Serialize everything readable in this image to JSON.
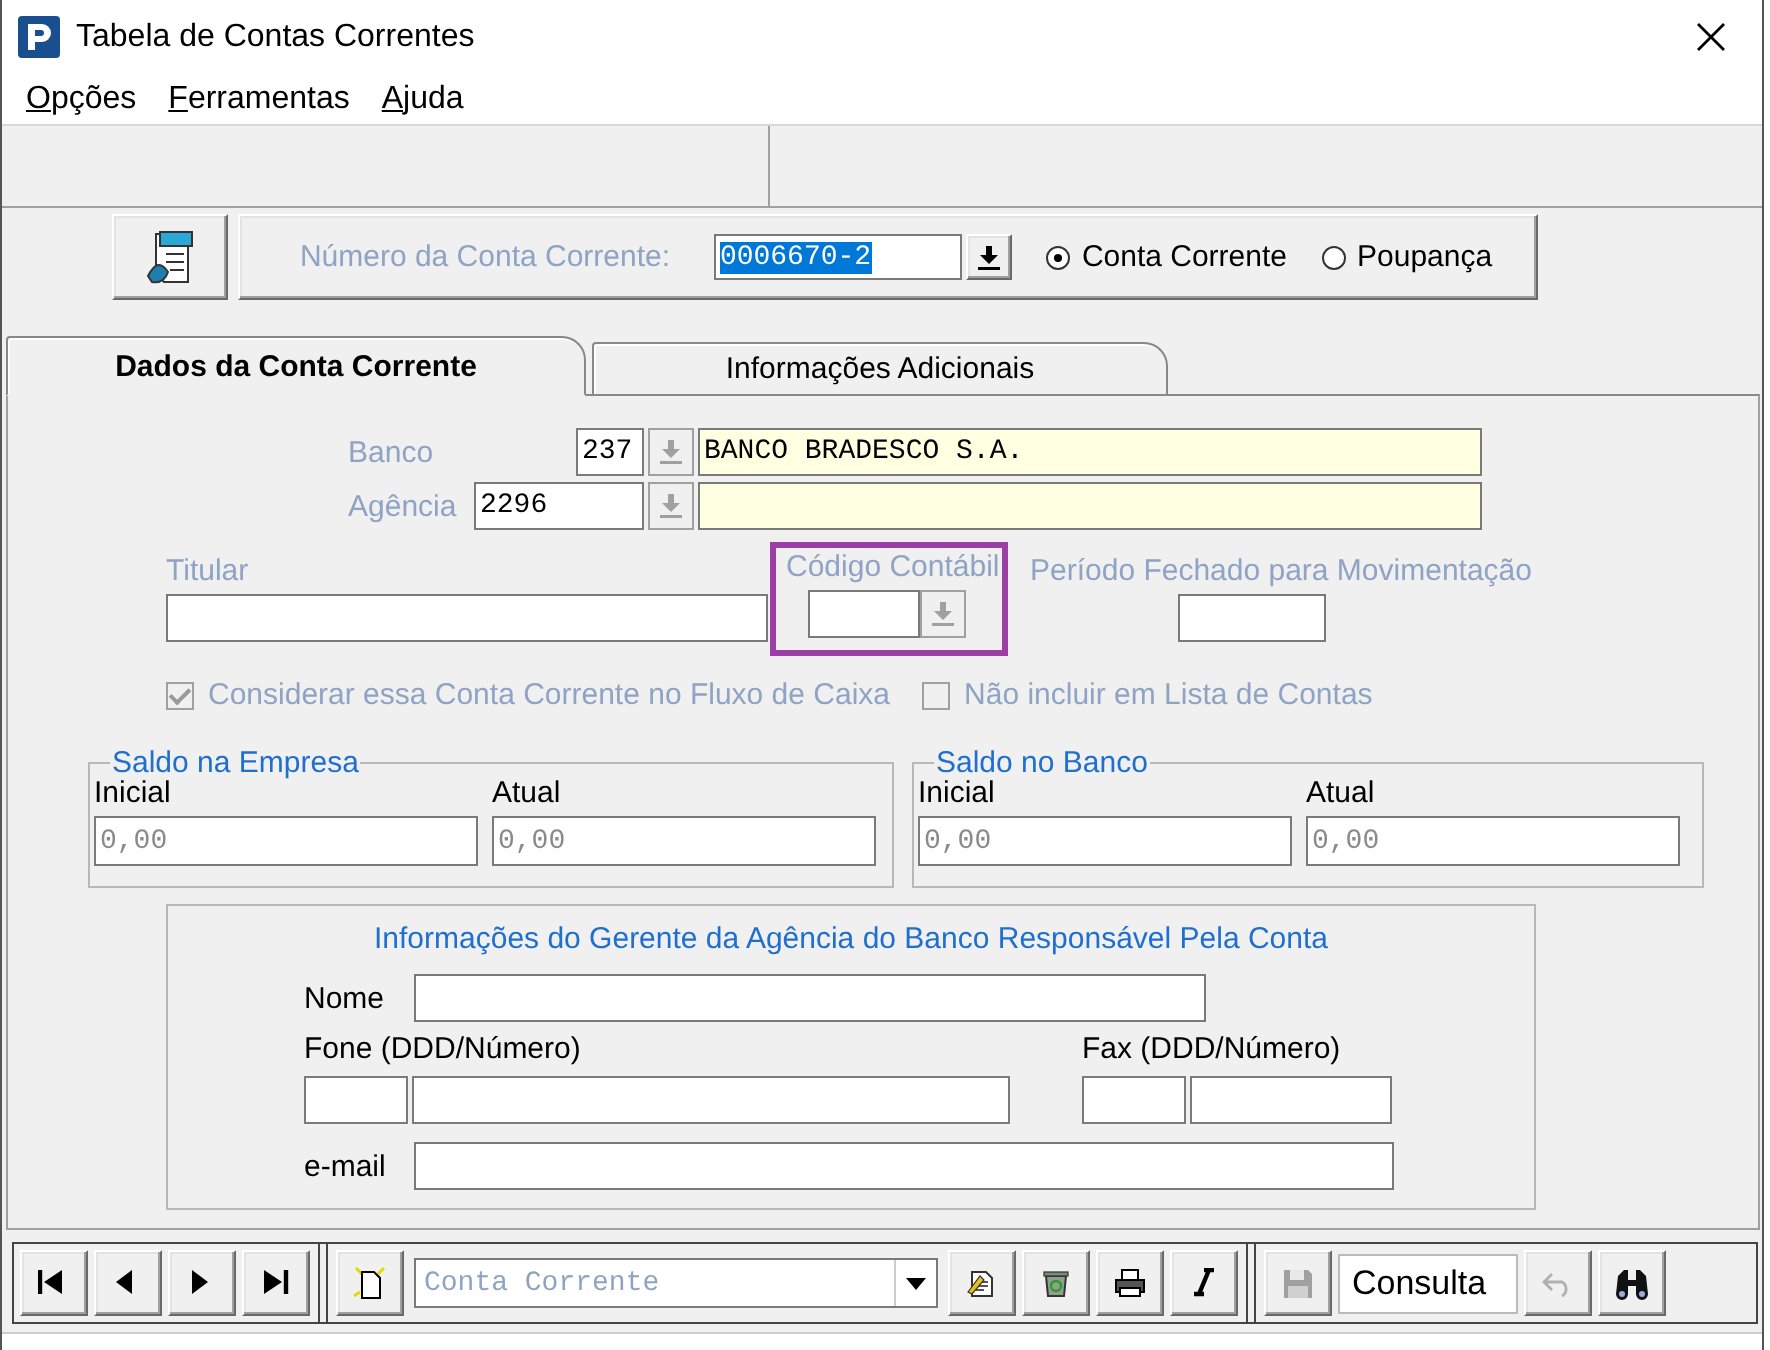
{
  "window": {
    "title": "Tabela de Contas Correntes"
  },
  "menu": [
    {
      "label": "Opções"
    },
    {
      "label": "Ferramentas"
    },
    {
      "label": "Ajuda"
    }
  ],
  "account": {
    "label": "Número da Conta Corrente:",
    "value": "0006670-2",
    "types": [
      {
        "label": "Conta Corrente",
        "selected": true
      },
      {
        "label": "Poupança",
        "selected": false
      }
    ]
  },
  "tabs": [
    {
      "label": "Dados da Conta Corrente",
      "selected": true
    },
    {
      "label": "Informações Adicionais",
      "selected": false
    }
  ],
  "bank": {
    "label": "Banco",
    "code": "237",
    "name": "BANCO BRADESCO S.A.",
    "disabled": true
  },
  "agency": {
    "label": "Agência",
    "code": "2296",
    "disabled": true
  },
  "holder": {
    "label": "Titular",
    "disabled": true
  },
  "ledger_code": {
    "label": "Código Contábil",
    "disabled": true,
    "highlighted": true
  },
  "closed_period": {
    "label": "Período Fechado para Movimentação",
    "disabled": true
  },
  "options": [
    {
      "label": "Considerar essa Conta Corrente no Fluxo de Caixa",
      "checked": true,
      "disabled": true
    },
    {
      "label": "Não incluir em Lista de Contas",
      "checked": false,
      "disabled": true
    }
  ],
  "balances": [
    {
      "title": "Saldo na Empresa",
      "fields": [
        {
          "label": "Inicial",
          "value": "0,00"
        },
        {
          "label": "Atual",
          "value": "0,00"
        }
      ]
    },
    {
      "title": "Saldo no Banco",
      "fields": [
        {
          "label": "Inicial",
          "value": "0,00"
        },
        {
          "label": "Atual",
          "value": "0,00"
        }
      ]
    }
  ],
  "manager": {
    "title": "Informações do Gerente da Agência do Banco Responsável Pela Conta",
    "name_label": "Nome",
    "phone_label": "Fone (DDD/Número)",
    "fax_label": "Fax (DDD/Número)",
    "email_label": "e-mail"
  },
  "toolbar": {
    "table_value": "Conta Corrente",
    "mode": "Consulta",
    "nav": [
      {
        "kind": "first"
      },
      {
        "kind": "previous"
      },
      {
        "kind": "next"
      },
      {
        "kind": "last"
      }
    ],
    "actions": [
      {
        "kind": "edit"
      },
      {
        "kind": "delete"
      },
      {
        "kind": "print"
      },
      {
        "kind": "italic"
      }
    ],
    "save": {
      "disabled": true
    },
    "undo": {
      "disabled": true
    }
  }
}
